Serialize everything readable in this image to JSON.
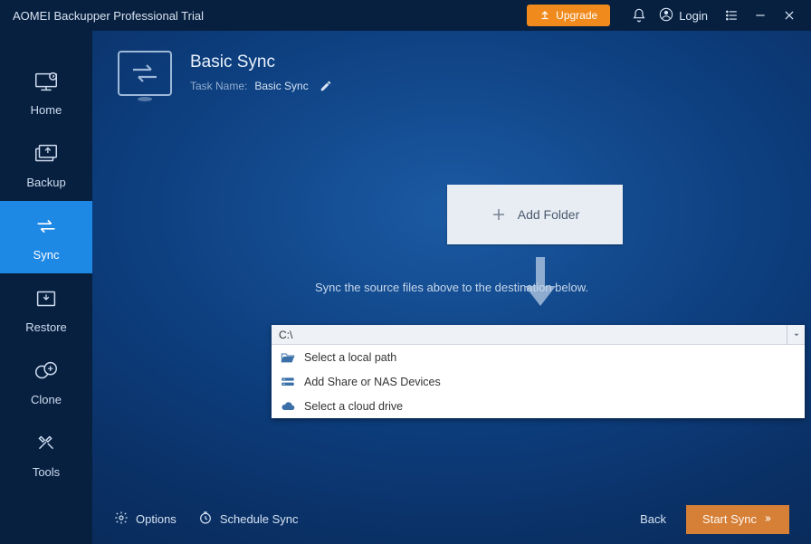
{
  "titlebar": {
    "app_title": "AOMEI Backupper Professional Trial",
    "upgrade_label": "Upgrade",
    "login_label": "Login"
  },
  "sidebar": {
    "items": [
      {
        "label": "Home"
      },
      {
        "label": "Backup"
      },
      {
        "label": "Sync"
      },
      {
        "label": "Restore"
      },
      {
        "label": "Clone"
      },
      {
        "label": "Tools"
      }
    ]
  },
  "header": {
    "title": "Basic Sync",
    "task_label": "Task Name:",
    "task_value": "Basic Sync"
  },
  "add_folder": {
    "label": "Add Folder"
  },
  "hint": "Sync the source files above to the destination below.",
  "destination": {
    "selected": "C:\\",
    "options": [
      {
        "label": "Select a local path"
      },
      {
        "label": "Add Share or NAS Devices"
      },
      {
        "label": "Select a cloud drive"
      }
    ]
  },
  "footer": {
    "options_label": "Options",
    "schedule_label": "Schedule Sync",
    "back_label": "Back",
    "start_label": "Start Sync"
  }
}
